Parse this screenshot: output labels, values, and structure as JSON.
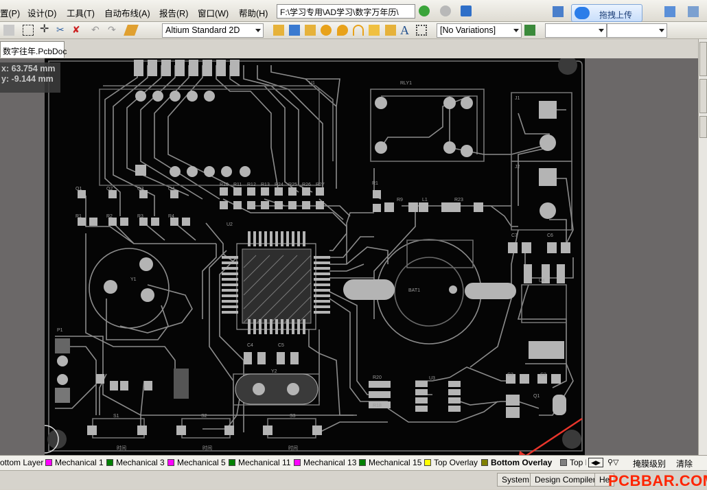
{
  "menus": [
    "置(P)",
    "设计(D)",
    "工具(T)",
    "自动布线(A)",
    "报告(R)",
    "窗口(W)",
    "帮助(H)"
  ],
  "path": "F:\\学习专用\\AD学习\\数字万年历\\",
  "upload_label": "拖拽上传",
  "toolbar": {
    "view_mode": "Altium Standard 2D",
    "variations": "[No Variations]",
    "combo_a": "",
    "combo_b": ""
  },
  "document_tab": "数字往年.PcbDoc",
  "coords": {
    "x": "x: 63.754 mm",
    "y": "y: -9.144  mm"
  },
  "pcb": {
    "relay": "RLY1",
    "u1": "U1",
    "battery": "BAT1",
    "p1": "P1",
    "j1": "J1",
    "j2": "J2",
    "u2": "U2",
    "u3": "U3",
    "u4": "U4",
    "y1": "Y1",
    "y2": "Y2",
    "q1": "Q1",
    "l1": "L1",
    "r9": "R9",
    "r23": "R23",
    "r1": "R1",
    "c4": "C4",
    "c5": "C5",
    "c6": "C6",
    "c7": "C7",
    "c2": "C2",
    "c3": "C3",
    "r18": "R18",
    "r20": "R20",
    "s1": "S1",
    "s2": "S2",
    "s3": "S3",
    "switch_label": "时间",
    "q_labels": [
      "Q1",
      "Q2",
      "Q3",
      "Q4"
    ],
    "r_labels": [
      "R1",
      "R2",
      "R3",
      "R4"
    ],
    "rn_labels": [
      "R10",
      "R11",
      "R12",
      "R13",
      "R24",
      "R25",
      "R26",
      "R27"
    ]
  },
  "layers": [
    {
      "name": "ottom Layer",
      "color": "#ffffff"
    },
    {
      "name": "Mechanical 1",
      "color": "#ff00ff"
    },
    {
      "name": "Mechanical 3",
      "color": "#008000"
    },
    {
      "name": "Mechanical 5",
      "color": "#ff00ff"
    },
    {
      "name": "Mechanical 11",
      "color": "#008000"
    },
    {
      "name": "Mechanical 13",
      "color": "#ff00ff"
    },
    {
      "name": "Mechanical 15",
      "color": "#008000"
    },
    {
      "name": "Top Overlay",
      "color": "#ffff00"
    },
    {
      "name": "Bottom Overlay",
      "color": "#808000"
    },
    {
      "name": "Top P",
      "color": "#808080"
    }
  ],
  "layer_actions": {
    "mask": "掩膜级别",
    "clear": "清除"
  },
  "status": {
    "system": "System",
    "compiler": "Design Compiler",
    "help": "He"
  },
  "watermark": "PCBBAR.COM",
  "colors": {
    "board": "#050505",
    "trace": "#8c8c8c",
    "pad": "#b4b4b4",
    "arrow": "#e8352b"
  }
}
